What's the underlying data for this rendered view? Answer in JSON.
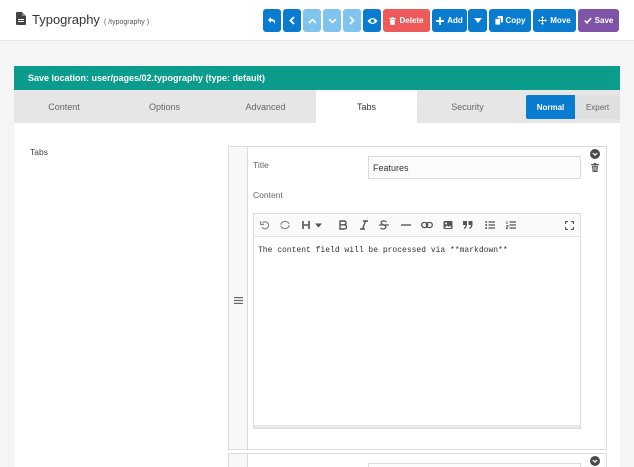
{
  "header": {
    "title": "Typography",
    "route": "( /typography )"
  },
  "toolbar": {
    "delete_label": "Delete",
    "add_label": "Add",
    "copy_label": "Copy",
    "move_label": "Move",
    "save_label": "Save"
  },
  "save_location": "Save location: user/pages/02.typography (type: default)",
  "tabs": [
    {
      "label": "Content"
    },
    {
      "label": "Options"
    },
    {
      "label": "Advanced"
    },
    {
      "label": "Tabs",
      "active": true
    },
    {
      "label": "Security"
    }
  ],
  "mode": {
    "normal_label": "Normal",
    "expert_label": "Expert"
  },
  "field": {
    "label": "Tabs"
  },
  "item": {
    "title_label": "Title",
    "title_value": "Features",
    "content_label": "Content",
    "content_value": "The content field will be processed via **markdown**"
  },
  "colors": {
    "primary": "#0a7cd0",
    "disabled": "#7ec4ee",
    "danger": "#ee5a5a",
    "save": "#7f53a5",
    "info_bar": "#0c9c8c"
  }
}
